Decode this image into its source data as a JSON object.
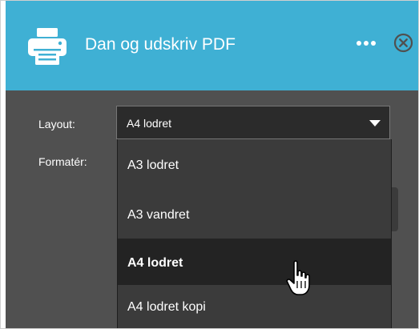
{
  "dialog": {
    "title": "Dan og udskriv PDF",
    "icons": {
      "print": "print-icon",
      "more": "more-icon",
      "close": "close-icon",
      "dropdown": "caret-down-icon",
      "cursor": "hand-cursor-icon"
    },
    "colors": {
      "header": "#3fb0d4",
      "panel": "#505050",
      "dropdown_bg": "#3b3b3b",
      "selected_bg": "#232323"
    }
  },
  "form": {
    "layout_label": "Layout:",
    "layout_value": "A4 lodret",
    "format_label": "Formatér:",
    "layout_options": [
      "A3 lodret",
      "A3 vandret",
      "A4 lodret",
      "A4 lodret kopi"
    ],
    "selected_option": "A4 lodret"
  }
}
